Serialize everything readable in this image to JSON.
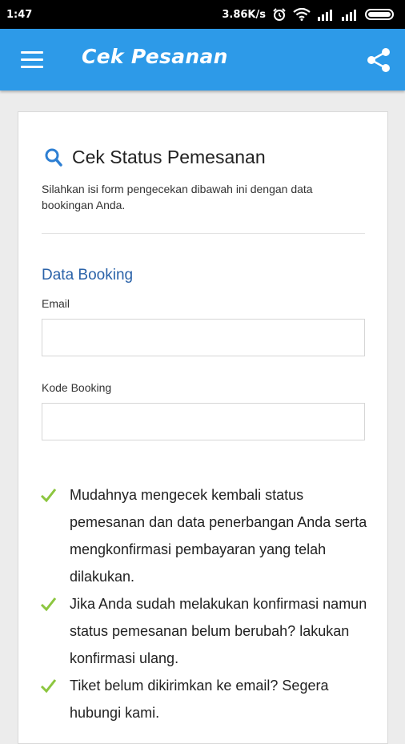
{
  "status_bar": {
    "time": "1:47",
    "net_speed": "3.86K/s",
    "alarm_icon": "alarm-clock-icon",
    "wifi_icon": "wifi-icon",
    "signal_icon": "signal-bars-icon",
    "battery_icon": "battery-icon"
  },
  "app_bar": {
    "title": "Cek Pesanan",
    "menu_icon": "hamburger-menu-icon",
    "share_icon": "share-icon",
    "color": "#2d9ae8"
  },
  "check_status": {
    "title": "Cek Status Pemesanan",
    "description": "Silahkan isi form pengecekan dibawah ini dengan data bookingan Anda.",
    "icon": "search-icon"
  },
  "form": {
    "section_title": "Data Booking",
    "email_label": "Email",
    "email_value": "",
    "booking_code_label": "Kode Booking",
    "booking_code_value": ""
  },
  "benefits": [
    "Mudahnya mengecek kembali status pemesanan dan data penerbangan Anda serta mengkonfirmasi pembayaran yang telah dilakukan.",
    "Jika Anda sudah melakukan konfirmasi namun status pemesanan belum berubah? lakukan konfirmasi ulang.",
    "Tiket belum dikirimkan ke email? Segera hubungi kami."
  ],
  "colors": {
    "accent": "#2d9ae8",
    "section_title": "#2a62a8",
    "check": "#8cc63f"
  }
}
